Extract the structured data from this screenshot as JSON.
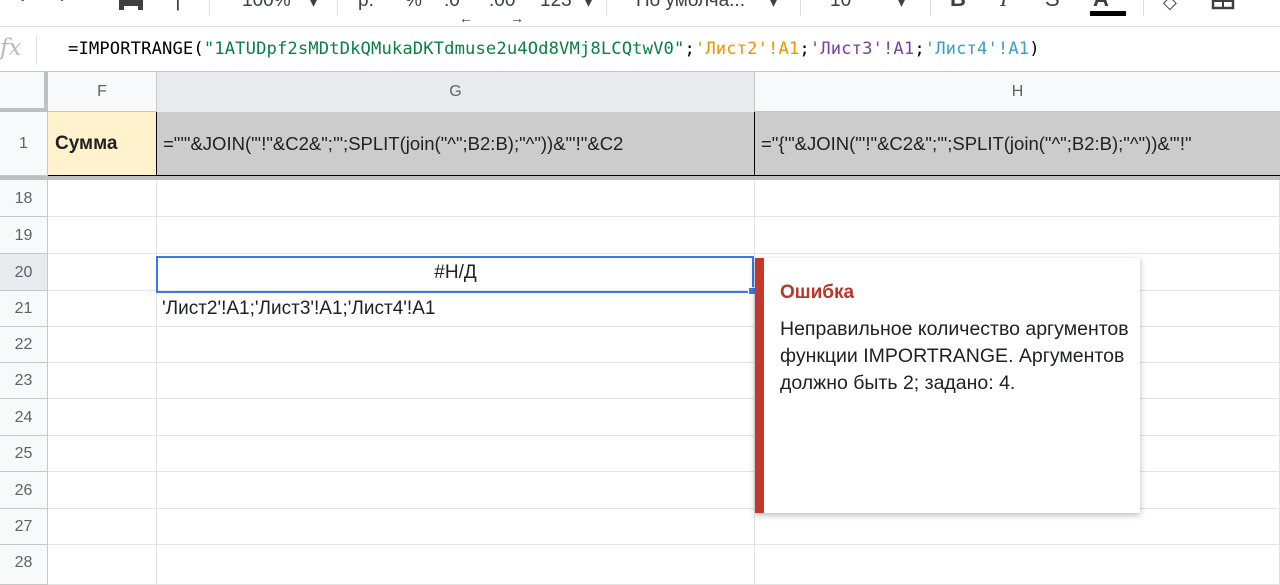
{
  "toolbar": {
    "zoom": "100%",
    "currency": "р.",
    "percent": "%",
    "decrease_decimals": ".0",
    "increase_decimals": ".00",
    "more_formats": "123",
    "font_family": "По умолча...",
    "font_size": "10",
    "bold": "B",
    "italic": "I",
    "strikethrough": "S",
    "text_color": "A"
  },
  "formula_bar": {
    "fx_label": "fx",
    "parts": {
      "prefix": "=IMPORTRANGE(",
      "key": "\"1ATUDpf2sMDtDkQMukaDKTdmuse2u4Od8VMj8LCQtwV0\"",
      "sep1": ";",
      "ref1_sheet": "'Лист2'",
      "ref1_cell": "!A1",
      "sep2": ";",
      "ref2_sheet": "'Лист3'",
      "ref2_cell": "!A1",
      "sep3": ";",
      "ref3_sheet": "'Лист4'",
      "ref3_cell": "!A1",
      "suffix": ")"
    }
  },
  "columns": [
    "F",
    "G",
    "H"
  ],
  "rows": [
    "1",
    "18",
    "19",
    "20",
    "21",
    "22",
    "23",
    "24",
    "25",
    "26",
    "27",
    "28"
  ],
  "cells": {
    "F1": "Сумма",
    "G1": "=\"'\"&JOIN(\"'!\"&C2&\";'\";SPLIT(join(\"^\";B2:B);\"^\"))&\"'!\"&C2",
    "H1": "=\"{'\"&JOIN(\"'!\"&C2&\";'\";SPLIT(join(\"^\";B2:B);\"^\"))&\"'!\"",
    "G20": "#Н/Д",
    "G21": "'Лист2'!A1;'Лист3'!A1;'Лист4'!A1"
  },
  "error_popup": {
    "title": "Ошибка",
    "message": "Неправильное количество аргументов функции IMPORTRANGE. Аргументов должно быть 2; задано: 4."
  },
  "colors": {
    "header_fill": "#fff2cc",
    "selection": "#3b78e7",
    "error_accent": "#c0392b",
    "frozen_fill": "#cccccc"
  }
}
